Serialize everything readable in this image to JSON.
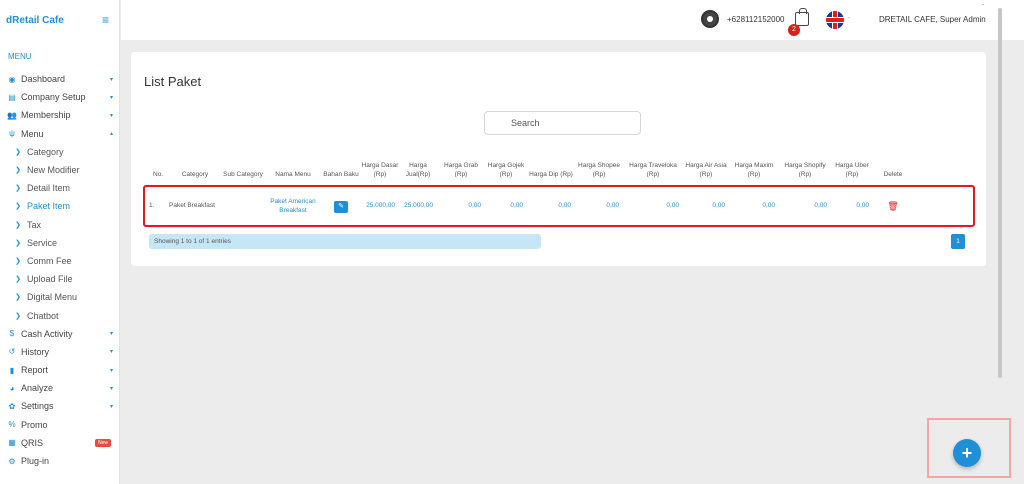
{
  "sidebar": {
    "brand": "dRetail Cafe",
    "menu_heading": "MENU",
    "items": [
      {
        "label": "Dashboard",
        "icon": "dashboard-icon",
        "caret": "▾"
      },
      {
        "label": "Company Setup",
        "icon": "building-icon",
        "caret": "▾"
      },
      {
        "label": "Membership",
        "icon": "users-icon",
        "caret": "▾"
      },
      {
        "label": "Menu",
        "icon": "cutlery-icon",
        "caret": "▴"
      }
    ],
    "sub_items": [
      {
        "label": "Category"
      },
      {
        "label": "New Modifier"
      },
      {
        "label": "Detail Item"
      },
      {
        "label": "Paket Item"
      },
      {
        "label": "Tax"
      },
      {
        "label": "Service"
      },
      {
        "label": "Comm Fee"
      },
      {
        "label": "Upload File"
      },
      {
        "label": "Digital Menu"
      },
      {
        "label": "Chatbot"
      }
    ],
    "bottom_items": [
      {
        "label": "Cash Activity",
        "icon": "dollar-icon",
        "caret": "▾"
      },
      {
        "label": "History",
        "icon": "history-icon",
        "caret": "▾"
      },
      {
        "label": "Report",
        "icon": "file-icon",
        "caret": "▾"
      },
      {
        "label": "Analyze",
        "icon": "chart-icon",
        "caret": "▾"
      },
      {
        "label": "Settings",
        "icon": "gear-icon",
        "caret": "▾"
      },
      {
        "label": "Promo",
        "icon": "percent-icon"
      },
      {
        "label": "QRIS",
        "icon": "qr-icon",
        "badge": "New"
      },
      {
        "label": "Plug-in",
        "icon": "plugin-icon"
      }
    ]
  },
  "topbar": {
    "phone": "+628112152000",
    "cart_count": "2",
    "language_dash": "-",
    "user": "DRETAIL CAFE, Super Admin",
    "user_caret": "˘"
  },
  "main": {
    "title": "List Paket",
    "search_placeholder": "Search",
    "columns": [
      "No.",
      "Category",
      "Sub Category",
      "Nama Menu",
      "Bahan Baku",
      "Harga Dasar (Rp)",
      "Harga Jual(Rp)",
      "Harga Grab (Rp)",
      "Harga Gojek (Rp)",
      "Harga Dip (Rp)",
      "Harga Shopee (Rp)",
      "Harga Traveloka (Rp)",
      "Harga Air Asia (Rp)",
      "Harga Maxim (Rp)",
      "Harga Shopify (Rp)",
      "Harga Uber (Rp)",
      "Delete"
    ],
    "rows": [
      {
        "no": "1.",
        "category": "Paket Breakfast",
        "sub_category": "",
        "nama_menu": "Paket American Breakfast",
        "harga_dasar": "25.000,00",
        "harga_jual": "25.000,00",
        "grab": "0,00",
        "gojek": "0,00",
        "dip": "0,00",
        "shopee": "0,00",
        "traveloka": "0,00",
        "airasia": "0,00",
        "maxim": "0,00",
        "shopify": "0,00",
        "uber": "0,00"
      }
    ],
    "info": "Showing 1 to 1 of 1 entries",
    "page": "1"
  },
  "fab_label": "+"
}
